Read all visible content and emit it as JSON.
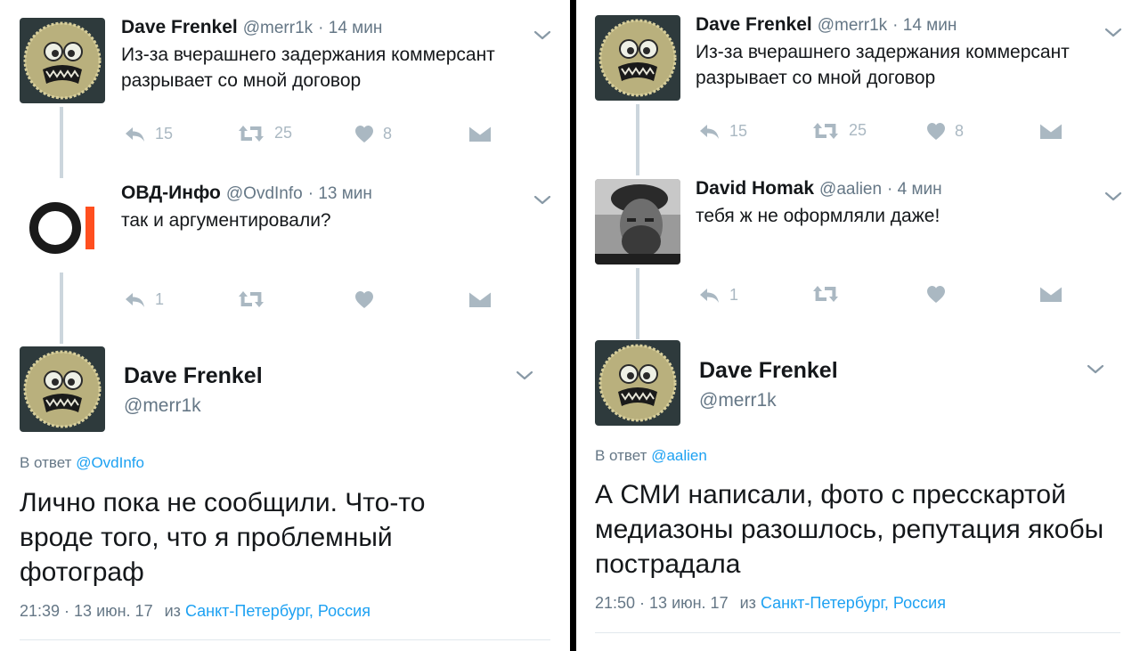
{
  "left": {
    "tweet1": {
      "name": "Dave Frenkel",
      "handle": "@merr1k",
      "time": "· 14 мин",
      "text": "Из-за вчерашнего задержания коммерсант разрывает со мной договор",
      "replies": "15",
      "retweets": "25",
      "likes": "8"
    },
    "tweet2": {
      "name": "ОВД-Инфо",
      "handle": "@OvdInfo",
      "time": "· 13 мин",
      "text": "так и аргументировали?",
      "replies": "1",
      "retweets": "",
      "likes": ""
    },
    "main": {
      "name": "Dave Frenkel",
      "handle": "@merr1k",
      "reply_prefix": "В ответ",
      "reply_to": "@OvdInfo",
      "text": "Лично пока не сообщили. Что-то вроде того, что я проблемный фотограф",
      "timestamp": "21:39 · 13 июн. 17",
      "from": "из",
      "location": "Санкт-Петербург, Россия"
    }
  },
  "right": {
    "tweet1": {
      "name": "Dave Frenkel",
      "handle": "@merr1k",
      "time": "· 14 мин",
      "text": "Из-за вчерашнего задержания коммерсант разрывает со мной договор",
      "replies": "15",
      "retweets": "25",
      "likes": "8"
    },
    "tweet2": {
      "name": "David Homak",
      "handle": "@aalien",
      "time": "· 4 мин",
      "text": "тебя ж не оформляли даже!",
      "replies": "1",
      "retweets": "",
      "likes": ""
    },
    "main": {
      "name": "Dave Frenkel",
      "handle": "@merr1k",
      "reply_prefix": "В ответ",
      "reply_to": "@aalien",
      "text": "А СМИ написали, фото с пресскартой медиазоны разошлось, репутация якобы пострадала",
      "timestamp": "21:50 · 13 июн. 17",
      "from": "из",
      "location": "Санкт-Петербург, Россия"
    }
  },
  "icons": {
    "chevron": "chevron-down-icon",
    "reply": "reply-icon",
    "retweet": "retweet-icon",
    "like": "heart-icon",
    "dm": "envelope-icon"
  },
  "colors": {
    "link": "#1da1f2",
    "icon_gray": "#aab8c2",
    "meta": "#657786",
    "ovd_orange": "#ff4f1f"
  }
}
